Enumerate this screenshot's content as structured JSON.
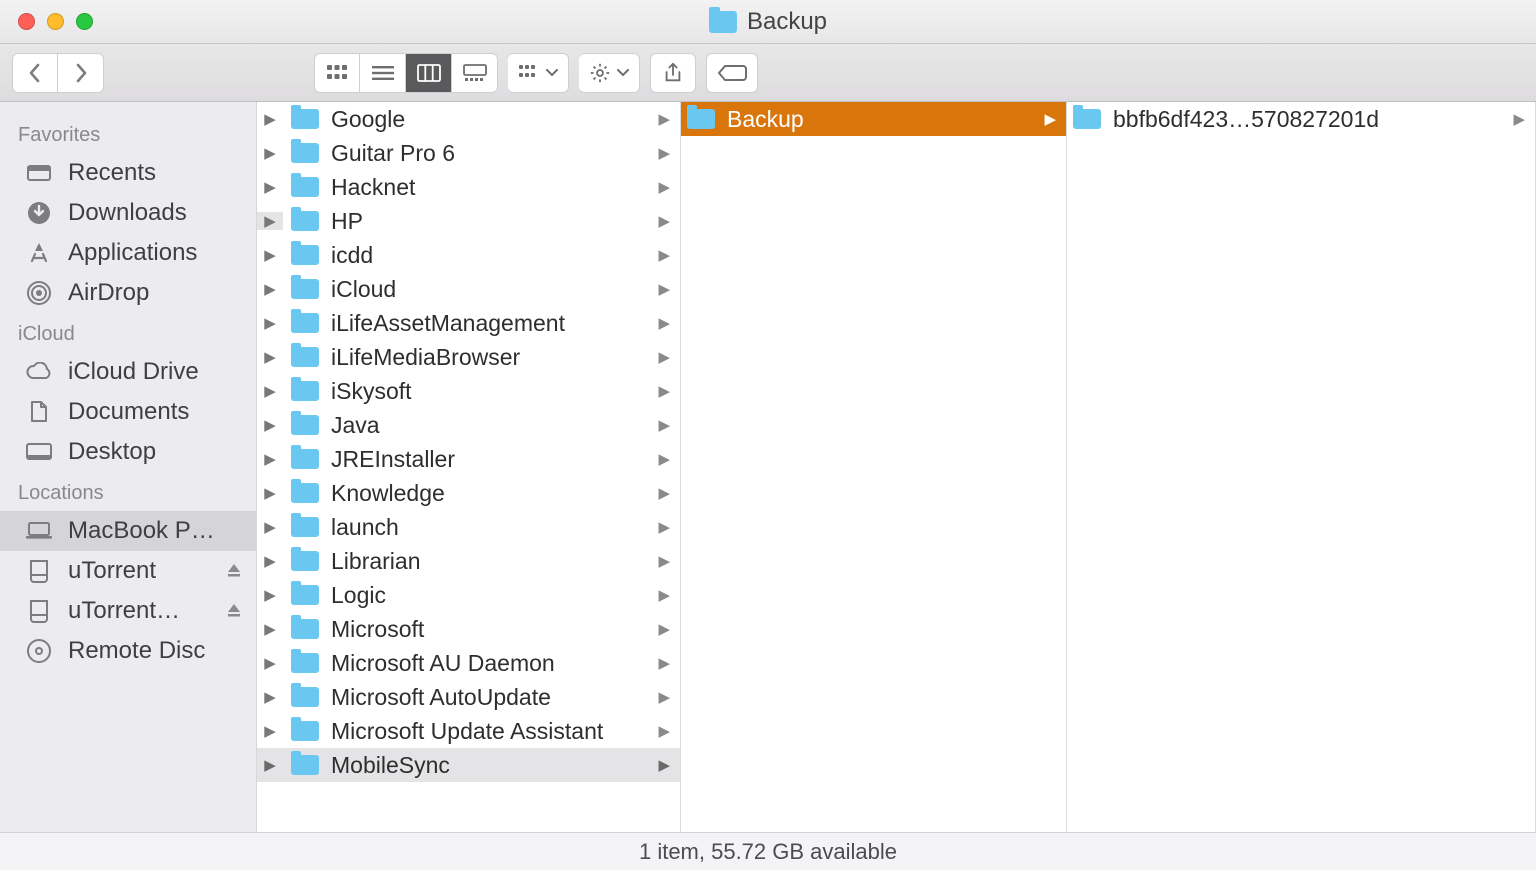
{
  "title": "Backup",
  "sidebar": {
    "sections": [
      {
        "heading": "Favorites",
        "items": [
          {
            "icon": "recents",
            "label": "Recents"
          },
          {
            "icon": "download",
            "label": "Downloads"
          },
          {
            "icon": "apps",
            "label": "Applications"
          },
          {
            "icon": "airdrop",
            "label": "AirDrop"
          }
        ]
      },
      {
        "heading": "iCloud",
        "items": [
          {
            "icon": "cloud",
            "label": "iCloud Drive"
          },
          {
            "icon": "docs",
            "label": "Documents"
          },
          {
            "icon": "desktop",
            "label": "Desktop"
          }
        ]
      },
      {
        "heading": "Locations",
        "items": [
          {
            "icon": "laptop",
            "label": "MacBook P…",
            "selected": true
          },
          {
            "icon": "disk",
            "label": "uTorrent",
            "eject": true
          },
          {
            "icon": "disk",
            "label": "uTorrent…",
            "eject": true
          },
          {
            "icon": "disc",
            "label": "Remote Disc"
          }
        ]
      }
    ]
  },
  "columns": {
    "col1": [
      {
        "name": "Google"
      },
      {
        "name": "Guitar Pro 6"
      },
      {
        "name": "Hacknet"
      },
      {
        "name": "HP",
        "lead_sel": true
      },
      {
        "name": "icdd"
      },
      {
        "name": "iCloud"
      },
      {
        "name": "iLifeAssetManagement"
      },
      {
        "name": "iLifeMediaBrowser"
      },
      {
        "name": "iSkysoft"
      },
      {
        "name": "Java"
      },
      {
        "name": "JREInstaller"
      },
      {
        "name": "Knowledge"
      },
      {
        "name": "launch"
      },
      {
        "name": "Librarian"
      },
      {
        "name": "Logic"
      },
      {
        "name": "Microsoft"
      },
      {
        "name": "Microsoft AU Daemon"
      },
      {
        "name": "Microsoft AutoUpdate"
      },
      {
        "name": "Microsoft Update Assistant"
      },
      {
        "name": "MobileSync",
        "selected": "light"
      }
    ],
    "col2": [
      {
        "name": "Backup",
        "selected": "orange"
      }
    ],
    "col3": [
      {
        "name": "bbfb6df423…570827201d"
      }
    ]
  },
  "status": "1 item, 55.72 GB available"
}
